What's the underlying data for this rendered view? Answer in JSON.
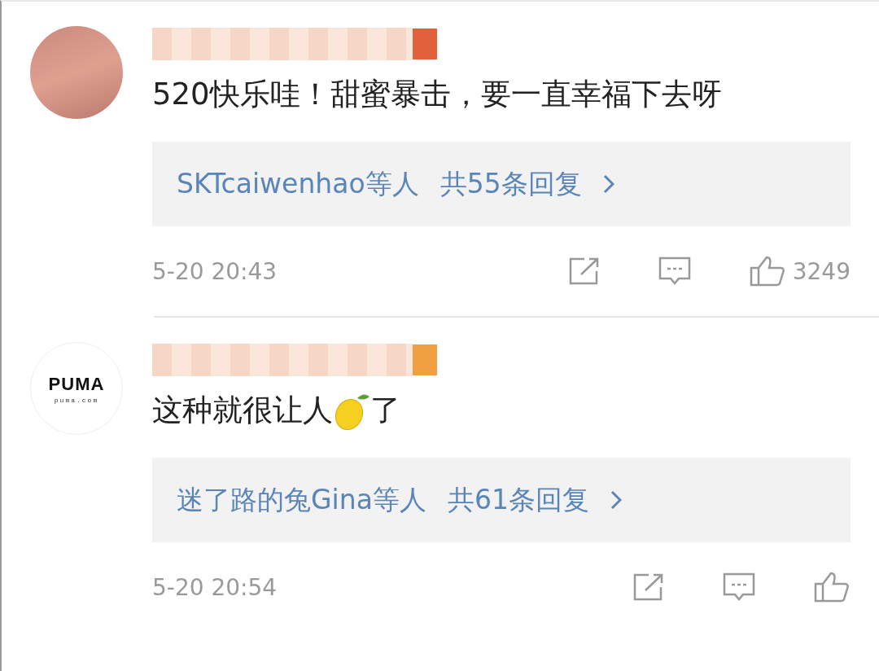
{
  "comments": [
    {
      "avatar": {
        "kind": "photo"
      },
      "segments": [
        {
          "kind": "text",
          "text": "520快乐哇！甜蜜暴击，要一直幸福下去呀"
        }
      ],
      "replies": {
        "names": "SKTcaiwenhao等人",
        "count": "共55条回复"
      },
      "time": "5-20 20:43",
      "likes": "3249",
      "color": "#e2603a"
    },
    {
      "avatar": {
        "kind": "logo",
        "wordmark": "PUMA",
        "site": "puma.com"
      },
      "segments": [
        {
          "kind": "text",
          "text": "这种就很让人"
        },
        {
          "kind": "lemon"
        },
        {
          "kind": "text",
          "text": "了"
        }
      ],
      "replies": {
        "names": "迷了路的兔Gina等人",
        "count": "共61条回复"
      },
      "time": "5-20 20:54",
      "color": "#f0a040"
    }
  ]
}
